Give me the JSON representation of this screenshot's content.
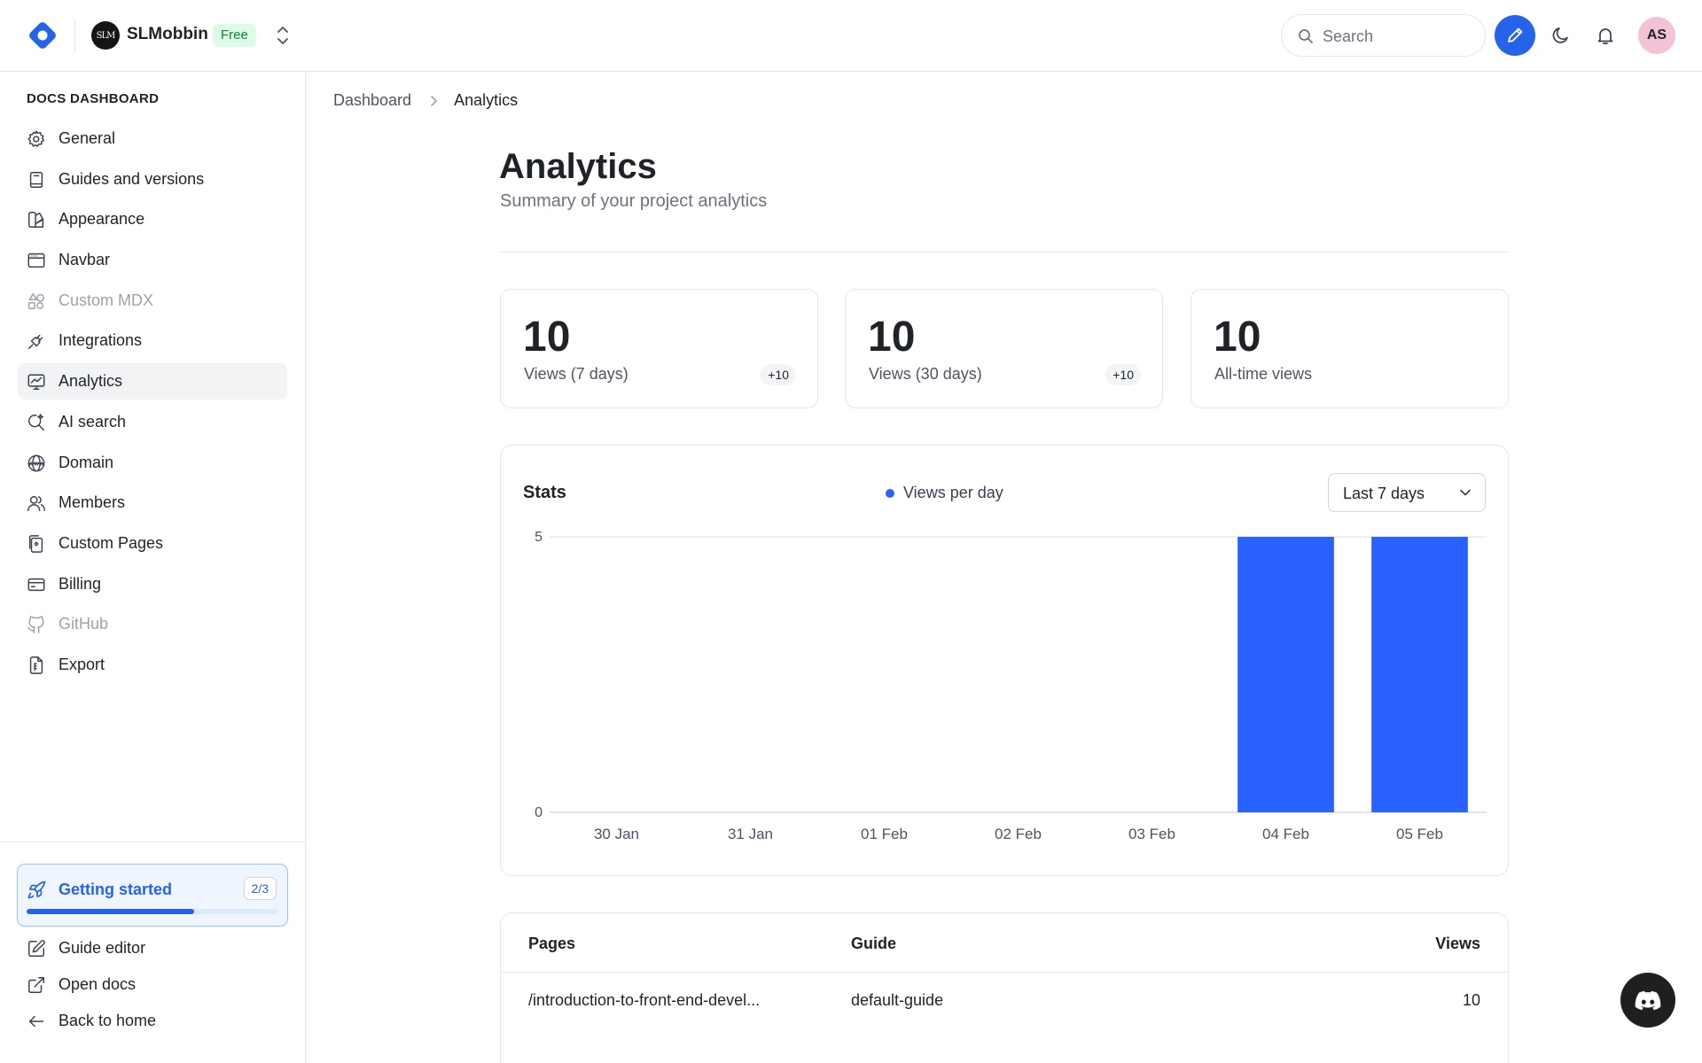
{
  "org": {
    "avatar_text": "SLM",
    "name": "SLMobbin",
    "plan": "Free"
  },
  "search": {
    "placeholder": "Search"
  },
  "user": {
    "initials": "AS"
  },
  "sidebar": {
    "heading": "DOCS DASHBOARD",
    "items": [
      {
        "label": "General",
        "icon": "gear-icon",
        "active": false,
        "muted": false
      },
      {
        "label": "Guides and versions",
        "icon": "book-icon",
        "active": false,
        "muted": false
      },
      {
        "label": "Appearance",
        "icon": "palette-icon",
        "active": false,
        "muted": false
      },
      {
        "label": "Navbar",
        "icon": "window-icon",
        "active": false,
        "muted": false
      },
      {
        "label": "Custom MDX",
        "icon": "shapes-icon",
        "active": false,
        "muted": true
      },
      {
        "label": "Integrations",
        "icon": "plug-icon",
        "active": false,
        "muted": false
      },
      {
        "label": "Analytics",
        "icon": "chart-monitor-icon",
        "active": true,
        "muted": false
      },
      {
        "label": "AI search",
        "icon": "sparkle-search-icon",
        "active": false,
        "muted": false
      },
      {
        "label": "Domain",
        "icon": "globe-icon",
        "active": false,
        "muted": false
      },
      {
        "label": "Members",
        "icon": "users-icon",
        "active": false,
        "muted": false
      },
      {
        "label": "Custom Pages",
        "icon": "pages-icon",
        "active": false,
        "muted": false
      },
      {
        "label": "Billing",
        "icon": "credit-card-icon",
        "active": false,
        "muted": false
      },
      {
        "label": "GitHub",
        "icon": "github-icon",
        "active": false,
        "muted": true
      },
      {
        "label": "Export",
        "icon": "export-file-icon",
        "active": false,
        "muted": false
      }
    ],
    "getting_started": {
      "label": "Getting started",
      "count": "2/3",
      "progress": 0.667
    },
    "bottom_items": [
      {
        "label": "Guide editor",
        "icon": "edit-square-icon"
      },
      {
        "label": "Open docs",
        "icon": "external-link-icon"
      },
      {
        "label": "Back to home",
        "icon": "arrow-left-icon"
      }
    ]
  },
  "breadcrumb": {
    "root": "Dashboard",
    "current": "Analytics"
  },
  "page": {
    "title": "Analytics",
    "subtitle": "Summary of your project analytics"
  },
  "stats": [
    {
      "value": "10",
      "label": "Views (7 days)",
      "delta": "+10"
    },
    {
      "value": "10",
      "label": "Views (30 days)",
      "delta": "+10"
    },
    {
      "value": "10",
      "label": "All-time views",
      "delta": ""
    }
  ],
  "stats_panel": {
    "title": "Stats",
    "range": "Last 7 days"
  },
  "chart_data": {
    "type": "bar",
    "title": "Stats",
    "categories": [
      "30 Jan",
      "31 Jan",
      "01 Feb",
      "02 Feb",
      "03 Feb",
      "04 Feb",
      "05 Feb"
    ],
    "series": [
      {
        "name": "Views per day",
        "values": [
          0,
          0,
          0,
          0,
          0,
          5,
          5
        ],
        "color": "#2962ff"
      }
    ],
    "y_ticks": [
      0,
      5
    ],
    "ylim": [
      0,
      5
    ],
    "grid": true,
    "legend_position": "top-center"
  },
  "pages_table": {
    "headers": {
      "pages": "Pages",
      "guide": "Guide",
      "views": "Views"
    },
    "rows": [
      {
        "page": "/introduction-to-front-end-devel...",
        "guide": "default-guide",
        "views": "10"
      }
    ]
  },
  "colors": {
    "accent": "#2563eb",
    "bar": "#2962ff",
    "badge_bg": "#dcfce7",
    "badge_fg": "#15803d"
  }
}
